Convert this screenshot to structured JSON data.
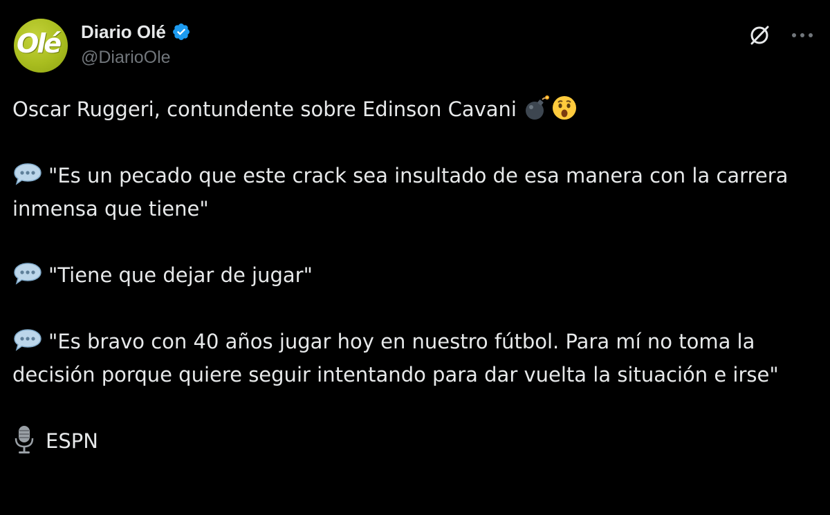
{
  "author": {
    "display_name": "Diario Olé",
    "handle": "@DiarioOle",
    "avatar_text": "Olé",
    "verified": true,
    "verified_color": "#1d9bf0",
    "avatar_color": "#a9bd1f"
  },
  "header_actions": {
    "grok_icon": "grok-icon",
    "more_icon": "more-icon"
  },
  "tweet": {
    "intro": "Oscar Ruggeri, contundente sobre Edinson Cavani",
    "quotes": [
      "\"Es un pecado que este crack sea insultado de esa manera con la carrera inmensa que tiene\"",
      "\"Tiene que dejar de jugar\"",
      "\"Es bravo con 40 años jugar hoy en nuestro fútbol. Para mí no toma la decisión porque quiere seguir intentando para dar vuelta la situación e irse\""
    ],
    "source": "ESPN"
  },
  "colors": {
    "background": "#000000",
    "text": "#e7e9ea",
    "secondary": "#71767b",
    "accent": "#1d9bf0"
  }
}
